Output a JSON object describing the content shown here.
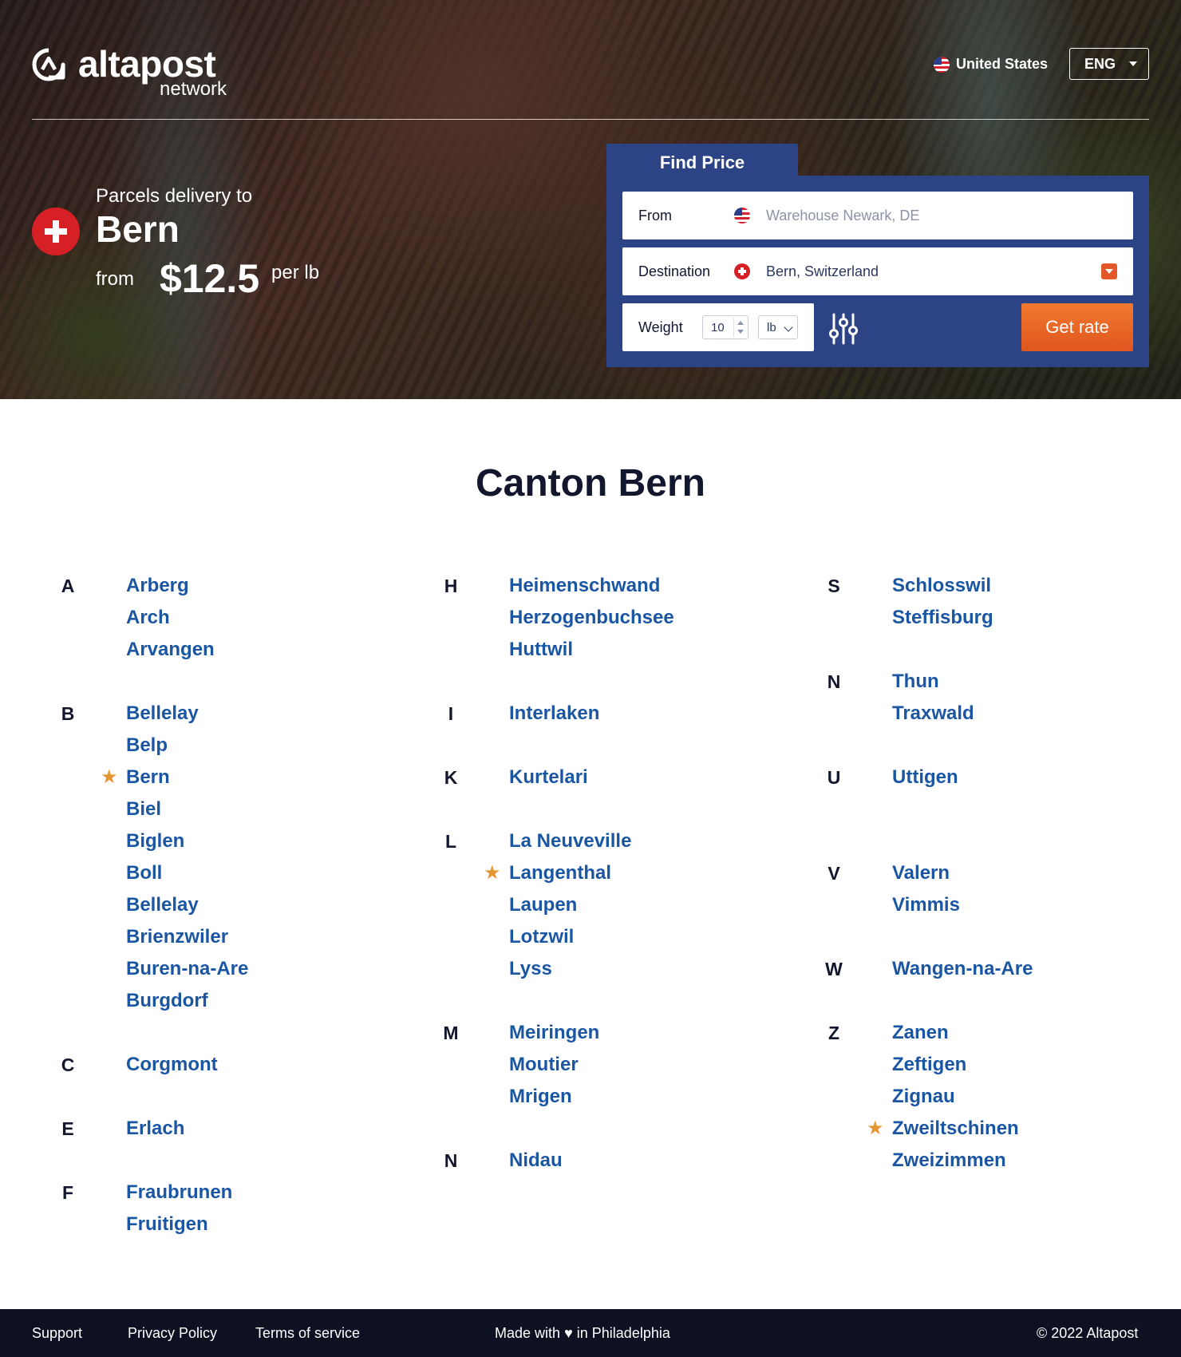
{
  "header": {
    "logo_name": "altapost",
    "logo_sub": "network",
    "country": "United States",
    "language": "ENG"
  },
  "promo": {
    "kicker": "Parcels delivery to",
    "city": "Bern",
    "from_label": "from",
    "price": "$12.5",
    "unit": "per lb"
  },
  "finder": {
    "tab_label": "Find Price",
    "from_label": "From",
    "from_placeholder": "Warehouse Newark, DE",
    "destination_label": "Destination",
    "destination_value": "Bern, Switzerland",
    "weight_label": "Weight",
    "weight_value": "10",
    "weight_unit": "lb",
    "button_label": "Get rate"
  },
  "directory": {
    "title": "Canton Bern",
    "columns": [
      [
        {
          "letter": "A",
          "cities": [
            {
              "name": "Arberg"
            },
            {
              "name": "Arch"
            },
            {
              "name": "Arvangen"
            }
          ]
        },
        {
          "letter": "B",
          "cities": [
            {
              "name": "Bellelay"
            },
            {
              "name": "Belp"
            },
            {
              "name": "Bern",
              "starred": true
            },
            {
              "name": "Biel"
            },
            {
              "name": "Biglen"
            },
            {
              "name": "Boll"
            },
            {
              "name": "Bellelay"
            },
            {
              "name": "Brienzwiler"
            },
            {
              "name": "Buren-na-Are"
            },
            {
              "name": "Burgdorf"
            }
          ]
        },
        {
          "letter": "C",
          "cities": [
            {
              "name": "Corgmont"
            }
          ]
        },
        {
          "letter": "E",
          "cities": [
            {
              "name": "Erlach"
            }
          ]
        },
        {
          "letter": "F",
          "cities": [
            {
              "name": "Fraubrunen"
            },
            {
              "name": "Fruitigen"
            }
          ]
        }
      ],
      [
        {
          "letter": "H",
          "cities": [
            {
              "name": "Heimenschwand"
            },
            {
              "name": "Herzogenbuchsee"
            },
            {
              "name": "Huttwil"
            }
          ]
        },
        {
          "letter": "I",
          "cities": [
            {
              "name": "Interlaken"
            }
          ]
        },
        {
          "letter": "K",
          "cities": [
            {
              "name": "Kurtelari"
            }
          ]
        },
        {
          "letter": "L",
          "cities": [
            {
              "name": "La Neuveville"
            },
            {
              "name": "Langenthal",
              "starred": true
            },
            {
              "name": "Laupen"
            },
            {
              "name": "Lotzwil"
            },
            {
              "name": "Lyss"
            }
          ]
        },
        {
          "letter": "M",
          "cities": [
            {
              "name": "Meiringen"
            },
            {
              "name": "Moutier"
            },
            {
              "name": "Mrigen"
            }
          ]
        },
        {
          "letter": "N",
          "cities": [
            {
              "name": "Nidau"
            }
          ]
        }
      ],
      [
        {
          "letter": "S",
          "cities": [
            {
              "name": "Schlosswil"
            },
            {
              "name": "Steffisburg"
            }
          ]
        },
        {
          "letter": "N",
          "cities": [
            {
              "name": "Thun"
            },
            {
              "name": "Traxwald"
            }
          ]
        },
        {
          "letter": "U",
          "cities": [
            {
              "name": "Uttigen"
            }
          ],
          "extra_gap": true
        },
        {
          "letter": "V",
          "cities": [
            {
              "name": "Valern"
            },
            {
              "name": "Vimmis"
            }
          ]
        },
        {
          "letter": "W",
          "cities": [
            {
              "name": "Wangen-na-Are"
            }
          ]
        },
        {
          "letter": "Z",
          "cities": [
            {
              "name": "Zanen"
            },
            {
              "name": "Zeftigen"
            },
            {
              "name": "Zignau"
            },
            {
              "name": "Zweiltschinen",
              "starred": true
            },
            {
              "name": "Zweizimmen"
            }
          ]
        }
      ]
    ]
  },
  "footer": {
    "support": "Support",
    "privacy": "Privacy Policy",
    "terms": "Terms of service",
    "made_with_prefix": "Made with",
    "made_with_suffix": "in Philadelphia",
    "copyright": "© 2022 Altapost"
  },
  "colors": {
    "brand_blue": "#2c4486",
    "link_blue": "#1b56a3",
    "accent_orange": "#e0561f",
    "star_orange": "#e69630",
    "swiss_red": "#d71f26",
    "footer_bg": "#0d1122"
  }
}
